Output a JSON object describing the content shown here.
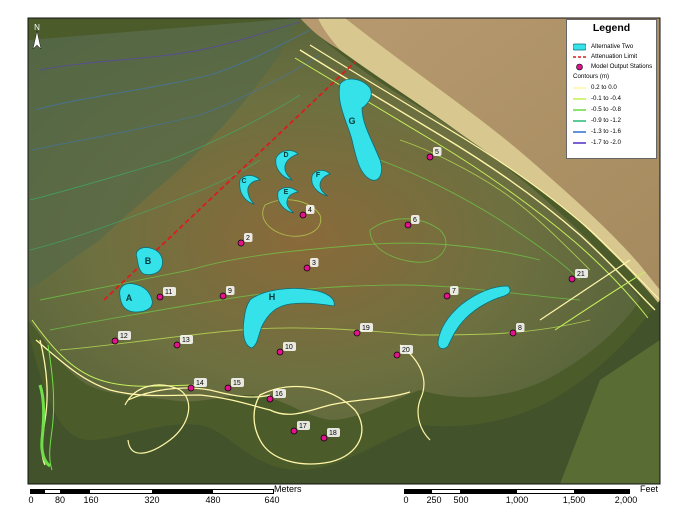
{
  "legend": {
    "title": "Legend",
    "items": {
      "alternative": "Alternative Two",
      "attenuation": "Attenuation Limit",
      "stations": "Model Output Stations",
      "contours_header": "Contours (m)"
    },
    "contour_classes": [
      {
        "label": "0.2 to 0.0",
        "color": "#fff6a8"
      },
      {
        "label": "-0.1 to -0.4",
        "color": "#c8f05a"
      },
      {
        "label": "-0.5 to -0.8",
        "color": "#6fe04a"
      },
      {
        "label": "-0.9 to -1.2",
        "color": "#34c07a"
      },
      {
        "label": "-1.3 to -1.6",
        "color": "#3a7ad0"
      },
      {
        "label": "-1.7 to -2.0",
        "color": "#5a3ac8"
      }
    ],
    "colors": {
      "alternative": "#36e2ea",
      "attenuation": "#d81e1e",
      "station_fill": "#e0128c"
    }
  },
  "north_arrow": "N",
  "sites": [
    "A",
    "B",
    "C",
    "D",
    "E",
    "F",
    "G",
    "H"
  ],
  "stations": [
    "2",
    "3",
    "4",
    "5",
    "6",
    "7",
    "8",
    "9",
    "10",
    "11",
    "12",
    "13",
    "14",
    "15",
    "16",
    "17",
    "18",
    "19",
    "20",
    "21"
  ],
  "scale_meters": {
    "unit": "Meters",
    "labels": [
      "0",
      "80",
      "160",
      "320",
      "480",
      "640"
    ]
  },
  "scale_feet": {
    "unit": "Feet",
    "labels": [
      "0",
      "250",
      "500",
      "1,000",
      "1,500",
      "2,000"
    ]
  }
}
